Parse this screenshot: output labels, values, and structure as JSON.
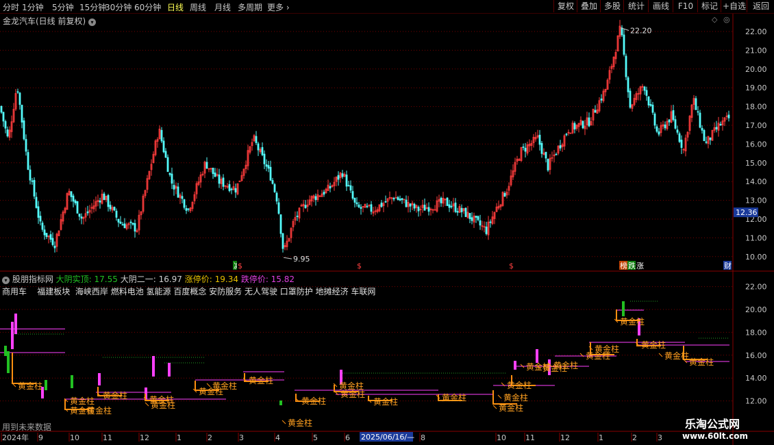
{
  "toolbar": {
    "periods": [
      "分时",
      "1分钟",
      "5分钟",
      "15分钟",
      "30分钟",
      "60分钟",
      "日线",
      "周线",
      "月线",
      "多周期",
      "更多"
    ],
    "active": "日线",
    "right_buttons": [
      "复权",
      "叠加",
      "多股",
      "统计",
      "画线",
      "F10",
      "标记",
      "+自选",
      "返回"
    ]
  },
  "main": {
    "title": "金龙汽车(日线 前复权)",
    "price_ticks": [
      "22.00",
      "21.00",
      "20.00",
      "19.00",
      "18.00",
      "17.00",
      "16.00",
      "15.00",
      "14.00",
      "13.00",
      "12.00",
      "11.00",
      "10.00"
    ],
    "current_price": "12.36",
    "high_label": "22.20",
    "low_label": "9.95",
    "event_markers": [
      "减",
      "$",
      "$",
      "$",
      "榜",
      "跌",
      "涨",
      "财"
    ]
  },
  "indicator": {
    "name": "股朋指标网",
    "values": [
      {
        "label": "大阴实顶: 17.55",
        "color": "#22c022"
      },
      {
        "label": "大阴二一: 16.97",
        "color": "#d0d0d0"
      },
      {
        "label": "涨停价: 19.34",
        "color": "#e8c000"
      },
      {
        "label": "跌停价: 15.82",
        "color": "#e040e0"
      }
    ],
    "concepts": "商用车    福建板块  海峡西岸 燃料电池 氢能源 百度概念 安防服务 无人驾驶 口罩防护 地摊经济 车联网",
    "price_ticks": [
      "22.00",
      "20.00",
      "18.00",
      "16.00",
      "14.00",
      "12.00"
    ],
    "marker_text": "黄金柱",
    "note": "用到未来数据"
  },
  "axis": {
    "labels": [
      "2024年",
      "9",
      "10",
      "11",
      "12",
      "1",
      "2",
      "3",
      "4",
      "5",
      "6",
      "8",
      "10",
      "11",
      "12",
      "1",
      "2",
      "3"
    ],
    "cursor_date": "2025/06/16/—"
  },
  "logo": {
    "line1": "乐淘公式网",
    "line2": "www.60lt.com"
  }
}
